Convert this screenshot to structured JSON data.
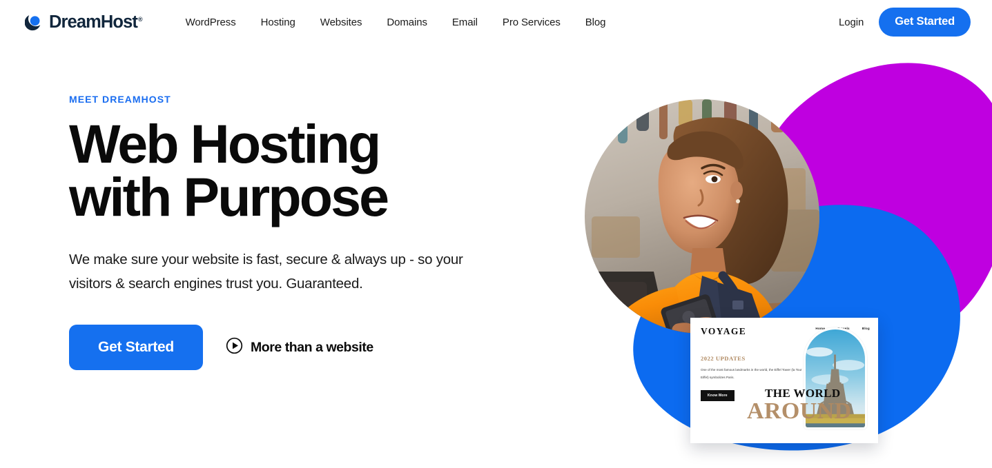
{
  "colors": {
    "brand_blue": "#1570EF",
    "accent_blue": "#1A6DF0",
    "blob_magenta": "#BF00E0",
    "blob_blue": "#0C6BF0",
    "logo_navy": "#11263C",
    "card_tan": "#B08A62",
    "text_dark": "#0a0a0a"
  },
  "header": {
    "logo": {
      "icon": "dreamhost-crescent-icon",
      "wordmark": "DreamHost",
      "registered_mark": "®"
    },
    "nav": [
      {
        "label": "WordPress"
      },
      {
        "label": "Hosting"
      },
      {
        "label": "Websites"
      },
      {
        "label": "Domains"
      },
      {
        "label": "Email"
      },
      {
        "label": "Pro Services"
      },
      {
        "label": "Blog"
      }
    ],
    "login_label": "Login",
    "get_started_label": "Get Started"
  },
  "hero": {
    "eyebrow": "MEET DREAMHOST",
    "title_line1": "Web Hosting",
    "title_line2": "with Purpose",
    "subtitle": "We make sure your website is fast, secure & always up - so your visitors & search engines trust you. Guaranteed.",
    "cta_primary": "Get Started",
    "video_link_label": "More than a website",
    "video_icon": "play-circle-icon"
  },
  "voyage_card": {
    "logo": "VOYAGE",
    "nav": [
      "Home",
      "Travels",
      "Blog"
    ],
    "kicker": "2022 UPDATES",
    "body": "One of the most famous landmarks in the world, the Eiffel Tower (la Tour Eiffel) symbolizes Paris.",
    "button": "Know More",
    "headline_top": "THE WORLD",
    "headline_bottom": "AROUND",
    "photo_subject": "eiffel-tower-arch-photo"
  },
  "hero_photo": {
    "subject": "smiling-woman-in-workshop-holding-phone",
    "back_crescent": "blurred-workshop-background"
  }
}
